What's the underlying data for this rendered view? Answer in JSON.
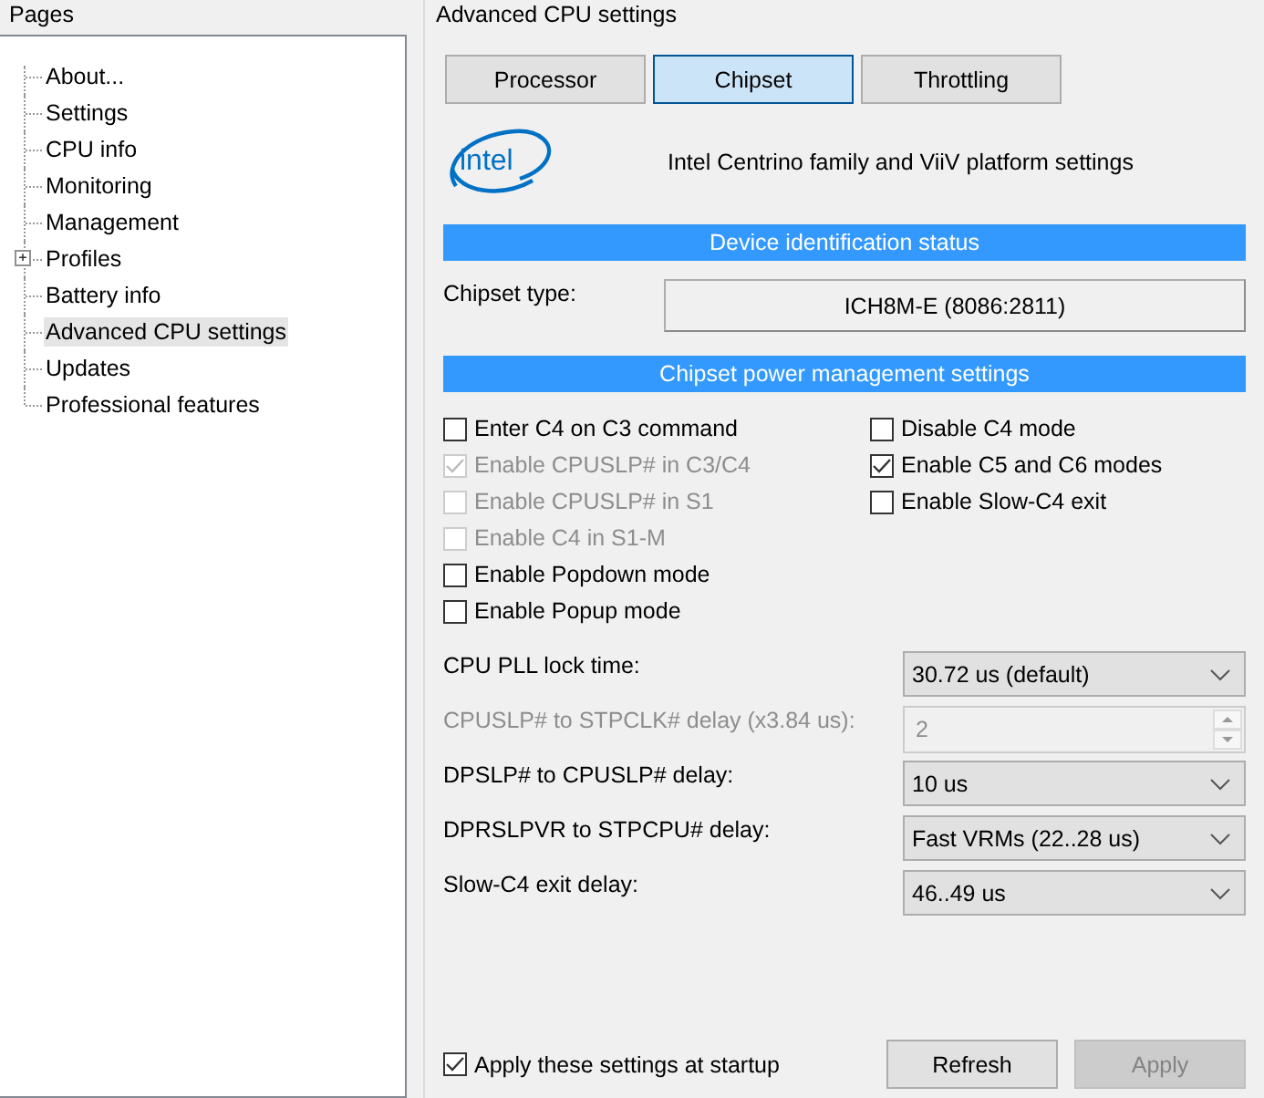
{
  "pages": {
    "title": "Pages",
    "items": [
      {
        "label": "About...",
        "kind": "leaf",
        "selected": false
      },
      {
        "label": "Settings",
        "kind": "leaf",
        "selected": false
      },
      {
        "label": "CPU info",
        "kind": "leaf",
        "selected": false
      },
      {
        "label": "Monitoring",
        "kind": "leaf",
        "selected": false
      },
      {
        "label": "Management",
        "kind": "leaf",
        "selected": false
      },
      {
        "label": "Profiles",
        "kind": "branch",
        "selected": false
      },
      {
        "label": "Battery info",
        "kind": "leaf",
        "selected": false
      },
      {
        "label": "Advanced CPU settings",
        "kind": "leaf",
        "selected": true
      },
      {
        "label": "Updates",
        "kind": "leaf",
        "selected": false
      },
      {
        "label": "Professional features",
        "kind": "leaf",
        "selected": false
      }
    ]
  },
  "panel": {
    "title": "Advanced CPU settings",
    "tabs": [
      {
        "label": "Processor",
        "selected": false
      },
      {
        "label": "Chipset",
        "selected": true
      },
      {
        "label": "Throttling",
        "selected": false
      }
    ],
    "logo": "intel",
    "heading": "Intel Centrino family and ViiV platform settings",
    "device_section": "Device identification status",
    "chipset_type": {
      "label": "Chipset type:",
      "value": "ICH8M-E (8086:2811)"
    },
    "power_section": "Chipset power management settings",
    "options_left": [
      {
        "label": "Enter C4 on C3 command",
        "checked": false,
        "disabled": false
      },
      {
        "label": "Enable CPUSLP# in C3/C4",
        "checked": true,
        "disabled": true
      },
      {
        "label": "Enable CPUSLP# in S1",
        "checked": false,
        "disabled": true
      },
      {
        "label": "Enable C4 in S1-M",
        "checked": false,
        "disabled": true
      },
      {
        "label": "Enable Popdown mode",
        "checked": false,
        "disabled": false
      },
      {
        "label": "Enable Popup mode",
        "checked": false,
        "disabled": false
      }
    ],
    "options_right": [
      {
        "label": "Disable C4 mode",
        "checked": false,
        "disabled": false
      },
      {
        "label": "Enable C5 and C6 modes",
        "checked": true,
        "disabled": false
      },
      {
        "label": "Enable Slow-C4 exit",
        "checked": false,
        "disabled": false
      }
    ],
    "settings": [
      {
        "label": "CPU PLL lock time:",
        "kind": "combo",
        "value": "30.72 us (default)",
        "disabled": false
      },
      {
        "label": "CPUSLP# to STPCLK# delay (x3.84 us):",
        "kind": "spin",
        "value": "2",
        "disabled": true
      },
      {
        "label": "DPSLP# to CPUSLP# delay:",
        "kind": "combo",
        "value": "10 us",
        "disabled": false
      },
      {
        "label": "DPRSLPVR to STPCPU# delay:",
        "kind": "combo",
        "value": "Fast VRMs (22..28 us)",
        "disabled": false
      },
      {
        "label": "Slow-C4 exit delay:",
        "kind": "combo",
        "value": "46..49 us",
        "disabled": false
      }
    ],
    "startup": {
      "label": "Apply these settings at startup",
      "checked": true,
      "disabled": false
    },
    "buttons": [
      {
        "label": "Refresh",
        "disabled": false
      },
      {
        "label": "Apply",
        "disabled": true
      }
    ]
  }
}
